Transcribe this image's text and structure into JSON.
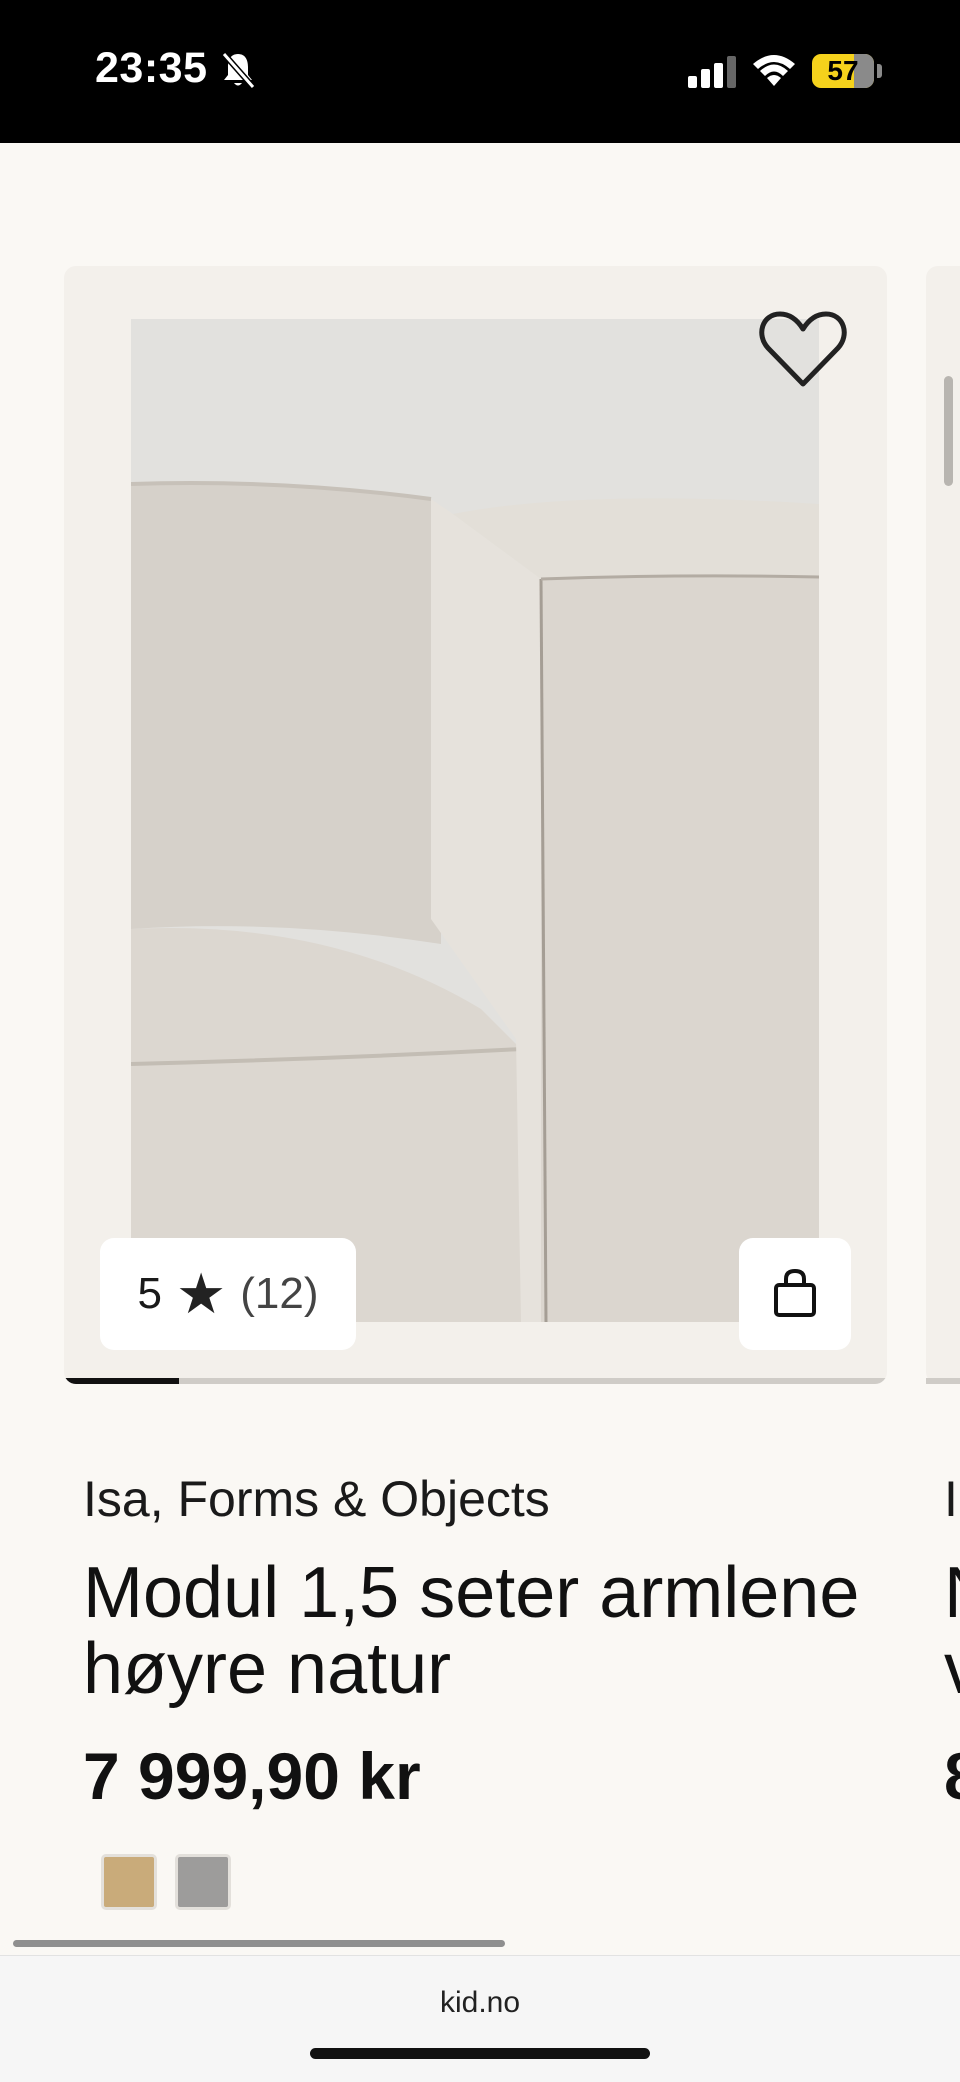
{
  "status_bar": {
    "time": "23:35",
    "battery": "57",
    "icons": [
      "bell-slash-icon",
      "cellular-signal-icon",
      "wifi-icon",
      "battery-icon"
    ]
  },
  "product": {
    "rating_value": "5",
    "rating_star": "★",
    "rating_count": "(12)",
    "brand": "Isa, Forms & Objects",
    "name": "Modul 1,5 seter armlene høyre natur",
    "price": "7 999,90 kr",
    "image_progress": 0.14,
    "swatches": [
      {
        "color": "#c9ab7a"
      },
      {
        "color": "#9d9c9b"
      }
    ],
    "icons": [
      "heart-icon",
      "shopping-bag-icon"
    ]
  },
  "next_product": {
    "brand_partial": "I",
    "name_partial_line1": "N",
    "name_partial_line2": "v",
    "price_partial": "8"
  },
  "browser": {
    "url": "kid.no"
  },
  "colors": {
    "page_bg": "#faf8f4",
    "card_bg": "#f3f0eb",
    "battery": "#f5d21c"
  }
}
